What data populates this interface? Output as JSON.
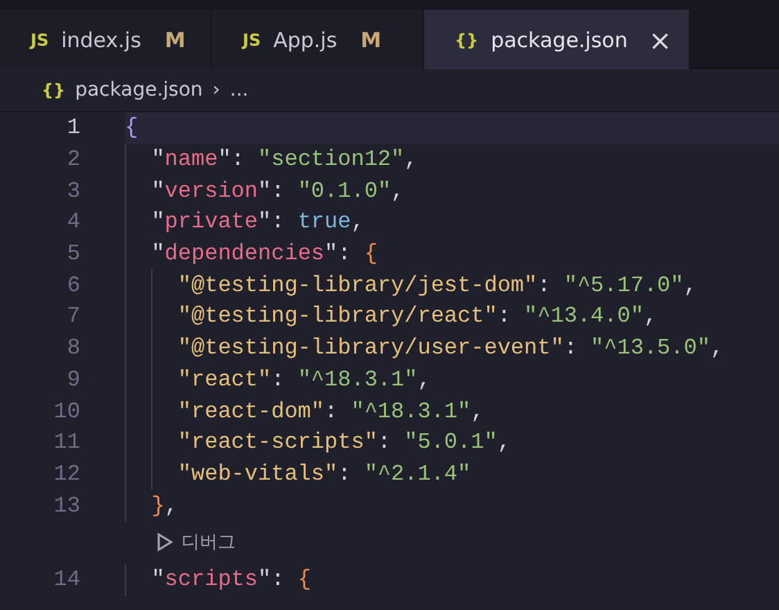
{
  "tabs": [
    {
      "icon": "JS",
      "label": "index.js",
      "modified": true,
      "badge": "M",
      "selected": false
    },
    {
      "icon": "JS",
      "label": "App.js",
      "modified": true,
      "badge": "M",
      "selected": false
    },
    {
      "icon": "{}",
      "label": "package.json",
      "modified": false,
      "selected": true,
      "close": "×"
    }
  ],
  "breadcrumb": {
    "icon": "{}",
    "file": "package.json",
    "separator": "›",
    "rest": "..."
  },
  "lines": [
    {
      "kind": "code",
      "number": "1",
      "current": true,
      "tokens": [
        {
          "kind": "brace1",
          "text": "{"
        }
      ],
      "children": [
        {
          "kind": "code",
          "number": "2",
          "current": false,
          "tokens": [
            {
              "kind": "punct",
              "text": "\""
            },
            {
              "kind": "key",
              "text": "name"
            },
            {
              "kind": "punct",
              "text": "\": "
            },
            {
              "kind": "string",
              "text": "\"section12\""
            },
            {
              "kind": "punct",
              "text": ","
            }
          ]
        },
        {
          "kind": "code",
          "number": "3",
          "current": false,
          "tokens": [
            {
              "kind": "punct",
              "text": "\""
            },
            {
              "kind": "key",
              "text": "version"
            },
            {
              "kind": "punct",
              "text": "\": "
            },
            {
              "kind": "string",
              "text": "\"0.1.0\""
            },
            {
              "kind": "punct",
              "text": ","
            }
          ]
        },
        {
          "kind": "code",
          "number": "4",
          "current": false,
          "tokens": [
            {
              "kind": "punct",
              "text": "\""
            },
            {
              "kind": "key",
              "text": "private"
            },
            {
              "kind": "punct",
              "text": "\": "
            },
            {
              "kind": "boolean",
              "text": "true"
            },
            {
              "kind": "punct",
              "text": ","
            }
          ]
        },
        {
          "kind": "code",
          "number": "5",
          "current": false,
          "tokens": [
            {
              "kind": "punct",
              "text": "\""
            },
            {
              "kind": "key",
              "text": "dependencies"
            },
            {
              "kind": "punct",
              "text": "\": "
            },
            {
              "kind": "brace2",
              "text": "{"
            }
          ],
          "children": [
            {
              "kind": "code",
              "number": "6",
              "current": false,
              "tokens": [
                {
                  "kind": "depkey",
                  "text": "\"@testing-library/jest-dom\""
                },
                {
                  "kind": "punct",
                  "text": ": "
                },
                {
                  "kind": "string",
                  "text": "\"^5.17.0\""
                },
                {
                  "kind": "punct",
                  "text": ","
                }
              ]
            },
            {
              "kind": "code",
              "number": "7",
              "current": false,
              "tokens": [
                {
                  "kind": "depkey",
                  "text": "\"@testing-library/react\""
                },
                {
                  "kind": "punct",
                  "text": ": "
                },
                {
                  "kind": "string",
                  "text": "\"^13.4.0\""
                },
                {
                  "kind": "punct",
                  "text": ","
                }
              ]
            },
            {
              "kind": "code",
              "number": "8",
              "current": false,
              "tokens": [
                {
                  "kind": "depkey",
                  "text": "\"@testing-library/user-event\""
                },
                {
                  "kind": "punct",
                  "text": ": "
                },
                {
                  "kind": "string",
                  "text": "\"^13.5.0\""
                },
                {
                  "kind": "punct",
                  "text": ","
                }
              ]
            },
            {
              "kind": "code",
              "number": "9",
              "current": false,
              "tokens": [
                {
                  "kind": "depkey",
                  "text": "\"react\""
                },
                {
                  "kind": "punct",
                  "text": ": "
                },
                {
                  "kind": "string",
                  "text": "\"^18.3.1\""
                },
                {
                  "kind": "punct",
                  "text": ","
                }
              ]
            },
            {
              "kind": "code",
              "number": "10",
              "current": false,
              "tokens": [
                {
                  "kind": "depkey",
                  "text": "\"react-dom\""
                },
                {
                  "kind": "punct",
                  "text": ": "
                },
                {
                  "kind": "string",
                  "text": "\"^18.3.1\""
                },
                {
                  "kind": "punct",
                  "text": ","
                }
              ]
            },
            {
              "kind": "code",
              "number": "11",
              "current": false,
              "tokens": [
                {
                  "kind": "depkey",
                  "text": "\"react-scripts\""
                },
                {
                  "kind": "punct",
                  "text": ": "
                },
                {
                  "kind": "string",
                  "text": "\"5.0.1\""
                },
                {
                  "kind": "punct",
                  "text": ","
                }
              ]
            },
            {
              "kind": "code",
              "number": "12",
              "current": false,
              "tokens": [
                {
                  "kind": "depkey",
                  "text": "\"web-vitals\""
                },
                {
                  "kind": "punct",
                  "text": ": "
                },
                {
                  "kind": "string",
                  "text": "\"^2.1.4\""
                }
              ]
            }
          ]
        },
        {
          "kind": "code",
          "number": "13",
          "current": false,
          "tokens": [
            {
              "kind": "brace2",
              "text": "}"
            },
            {
              "kind": "punct",
              "text": ","
            }
          ]
        },
        {
          "kind": "codelens",
          "label": "디버그"
        },
        {
          "kind": "code",
          "number": "14",
          "current": false,
          "tokens": [
            {
              "kind": "punct",
              "text": "\""
            },
            {
              "kind": "key",
              "text": "scripts"
            },
            {
              "kind": "punct",
              "text": "\": "
            },
            {
              "kind": "brace2",
              "text": "{"
            }
          ]
        }
      ]
    }
  ]
}
